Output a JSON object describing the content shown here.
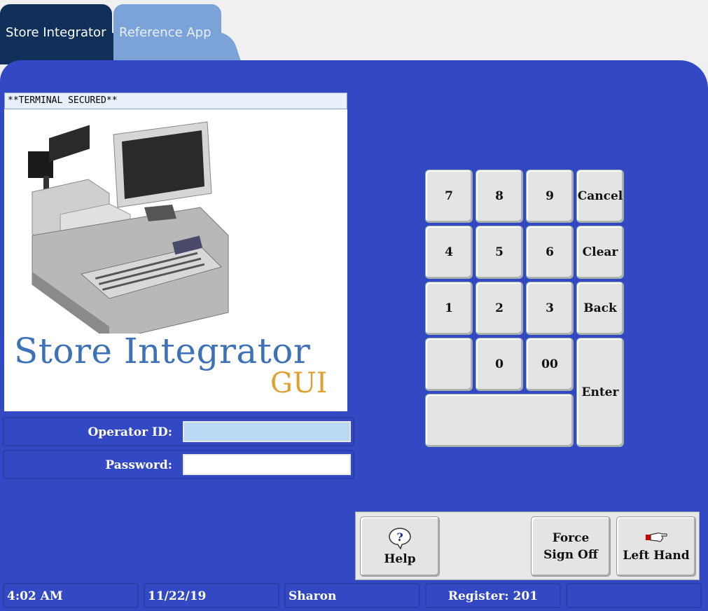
{
  "tabs": [
    {
      "label": "Store Integrator",
      "active": true
    },
    {
      "label": "Reference App",
      "active": false
    }
  ],
  "terminal_status": "**TERMINAL SECURED**",
  "logo": {
    "title": "Store Integrator",
    "subtitle": "GUI"
  },
  "login": {
    "operator_label": "Operator ID:",
    "operator_value": "",
    "password_label": "Password:",
    "password_value": ""
  },
  "keypad": {
    "k7": "7",
    "k8": "8",
    "k9": "9",
    "cancel": "Cancel",
    "k4": "4",
    "k5": "5",
    "k6": "6",
    "clear": "Clear",
    "k1": "1",
    "k2": "2",
    "k3": "3",
    "back": "Back",
    "k0": "0",
    "k00": "00",
    "enter": "Enter"
  },
  "function_keys": {
    "help": "Help",
    "force_line1": "Force",
    "force_line2": "Sign Off",
    "left_hand": "Left Hand"
  },
  "status_bar": {
    "time": "4:02 AM",
    "date": "11/22/19",
    "operator": "Sharon",
    "register": "Register: 201",
    "extra": ""
  },
  "colors": {
    "background": "#3349c4",
    "tab_active": "#10305a",
    "tab_inactive": "#7ba3d8",
    "operator_field": "#b8d8f4"
  }
}
